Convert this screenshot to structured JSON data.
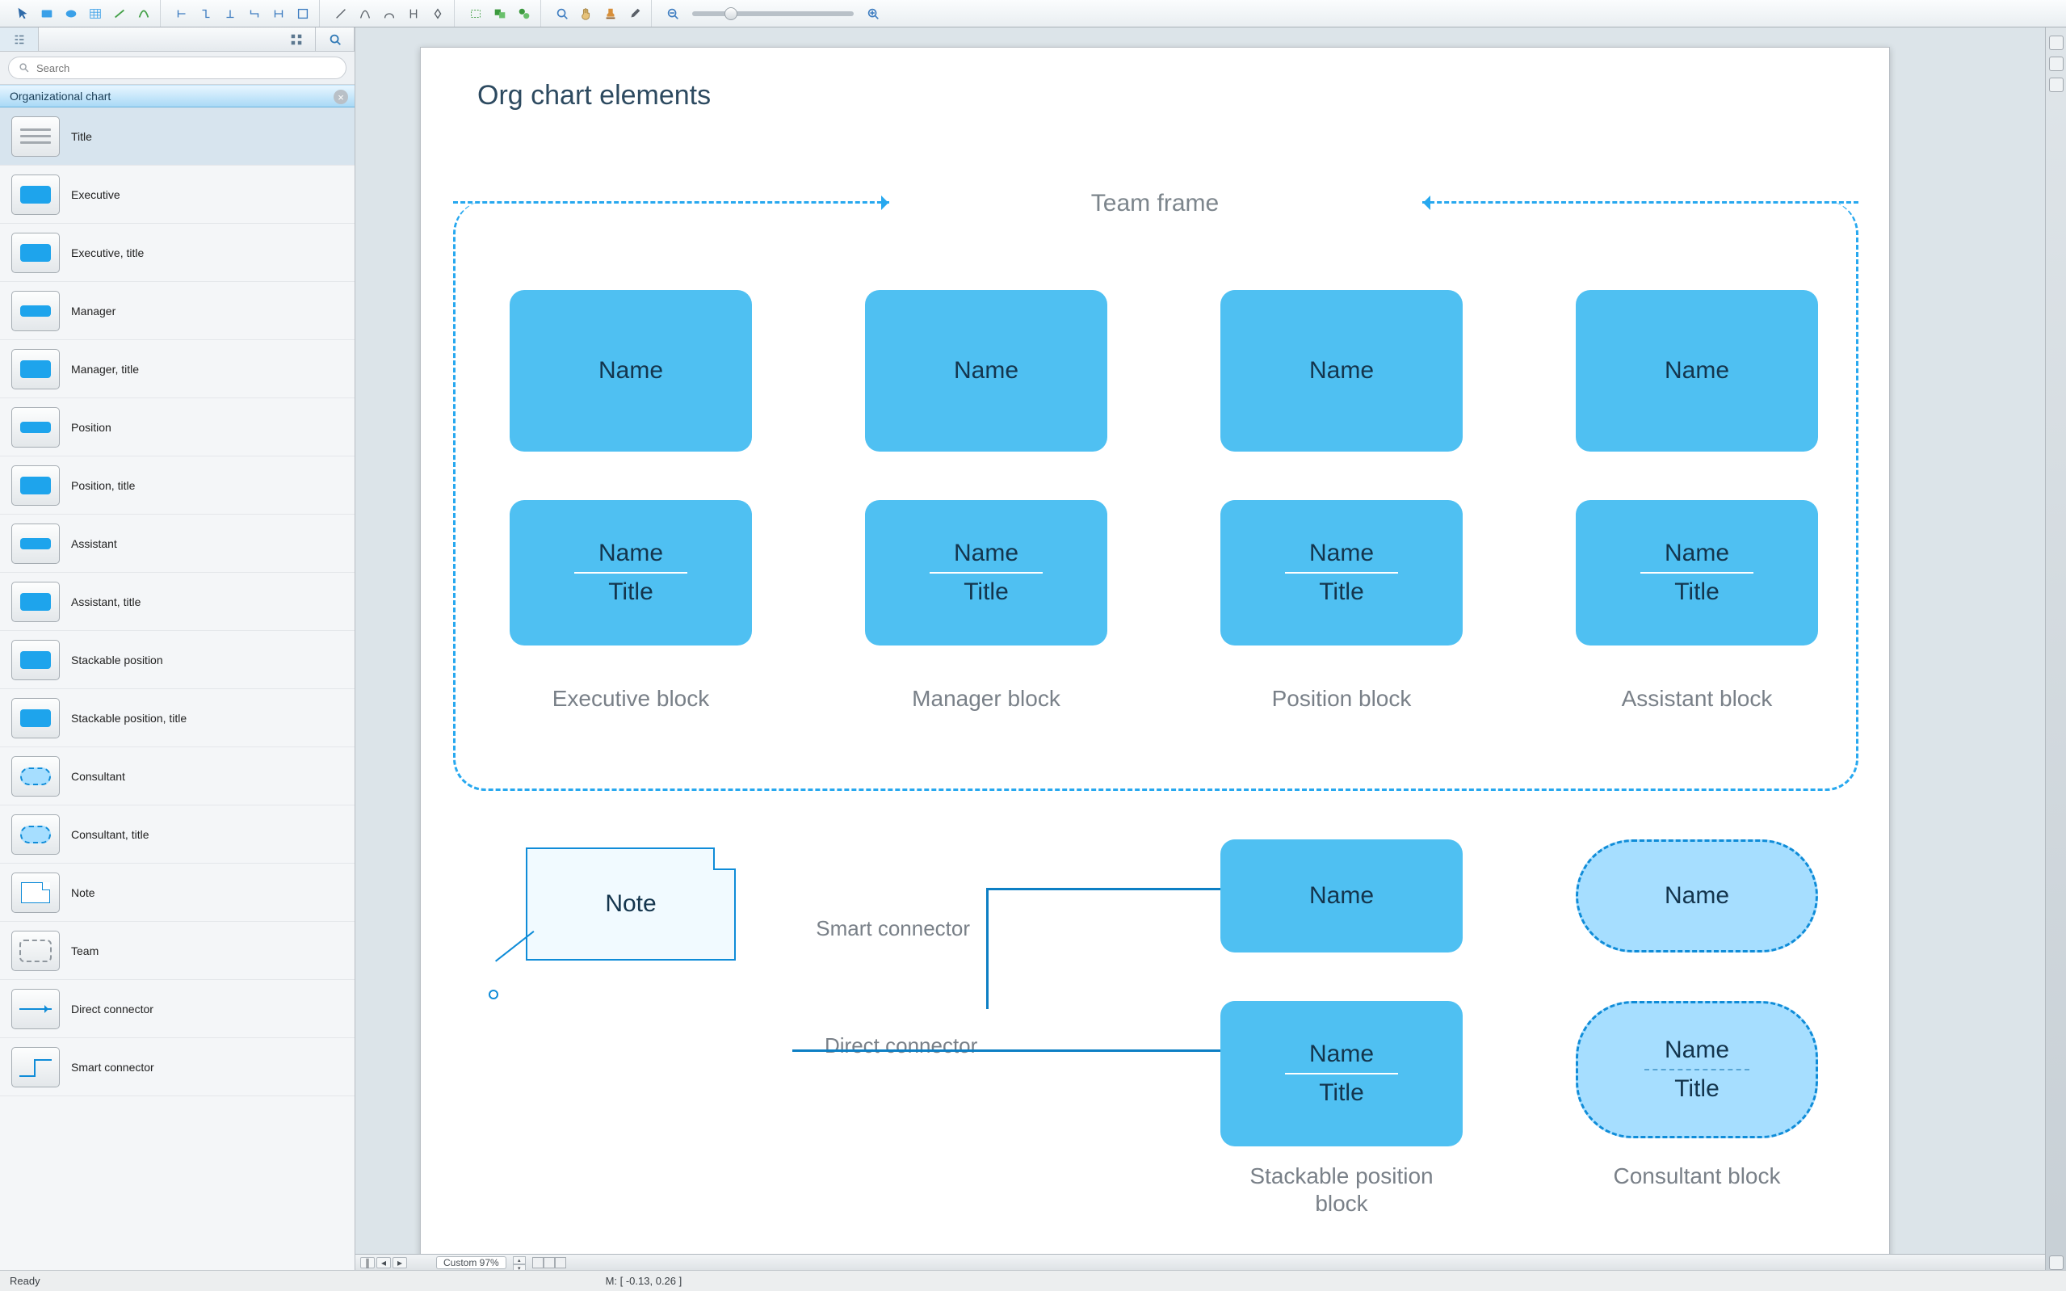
{
  "toolbar_groups": [
    [
      "pointer",
      "rect",
      "ellipse",
      "table",
      "line",
      "curve"
    ],
    [
      "connector-1",
      "connector-2",
      "connector-3",
      "connector-4",
      "connector-5",
      "connector-6"
    ],
    [
      "layout-1",
      "layout-2",
      "layout-3",
      "layout-4",
      "layout-5"
    ],
    [
      "shape-1",
      "shape-2",
      "shape-3"
    ],
    [
      "zoom-fit",
      "hand",
      "stamp",
      "eyedropper"
    ]
  ],
  "sidebar": {
    "search_placeholder": "Search",
    "category": "Organizational chart",
    "items": [
      {
        "id": "title",
        "label": "Title",
        "thumb": "lines"
      },
      {
        "id": "executive",
        "label": "Executive",
        "thumb": "rect"
      },
      {
        "id": "executive_title",
        "label": "Executive, title",
        "thumb": "rect"
      },
      {
        "id": "manager",
        "label": "Manager",
        "thumb": "rect-small"
      },
      {
        "id": "manager_title",
        "label": "Manager, title",
        "thumb": "rect"
      },
      {
        "id": "position",
        "label": "Position",
        "thumb": "rect-small"
      },
      {
        "id": "position_title",
        "label": "Position, title",
        "thumb": "rect"
      },
      {
        "id": "assistant",
        "label": "Assistant",
        "thumb": "rect-small"
      },
      {
        "id": "assistant_title",
        "label": "Assistant, title",
        "thumb": "rect"
      },
      {
        "id": "stackable_position",
        "label": "Stackable position",
        "thumb": "rect"
      },
      {
        "id": "stackable_position_title",
        "label": "Stackable position, title",
        "thumb": "rect"
      },
      {
        "id": "consultant",
        "label": "Consultant",
        "thumb": "dashrect"
      },
      {
        "id": "consultant_title",
        "label": "Consultant, title",
        "thumb": "dashrect"
      },
      {
        "id": "note",
        "label": "Note",
        "thumb": "note"
      },
      {
        "id": "team",
        "label": "Team",
        "thumb": "team"
      },
      {
        "id": "direct_connector",
        "label": "Direct connector",
        "thumb": "arrow"
      },
      {
        "id": "smart_connector",
        "label": "Smart connector",
        "thumb": "smart"
      }
    ],
    "selected": "title"
  },
  "canvas": {
    "heading": "Org chart elements",
    "team_frame_label": "Team frame",
    "name_label": "Name",
    "title_label": "Title",
    "captions": {
      "executive": "Executive block",
      "manager": "Manager block",
      "position": "Position block",
      "assistant": "Assistant block",
      "stackable": "Stackable position block",
      "consultant": "Consultant block"
    },
    "note_label": "Note",
    "smart_connector": "Smart connector",
    "direct_connector": "Direct connector"
  },
  "footer": {
    "zoom_label": "Custom 97%",
    "status": "Ready",
    "mouse": "M: [ -0.13, 0.26 ]"
  }
}
